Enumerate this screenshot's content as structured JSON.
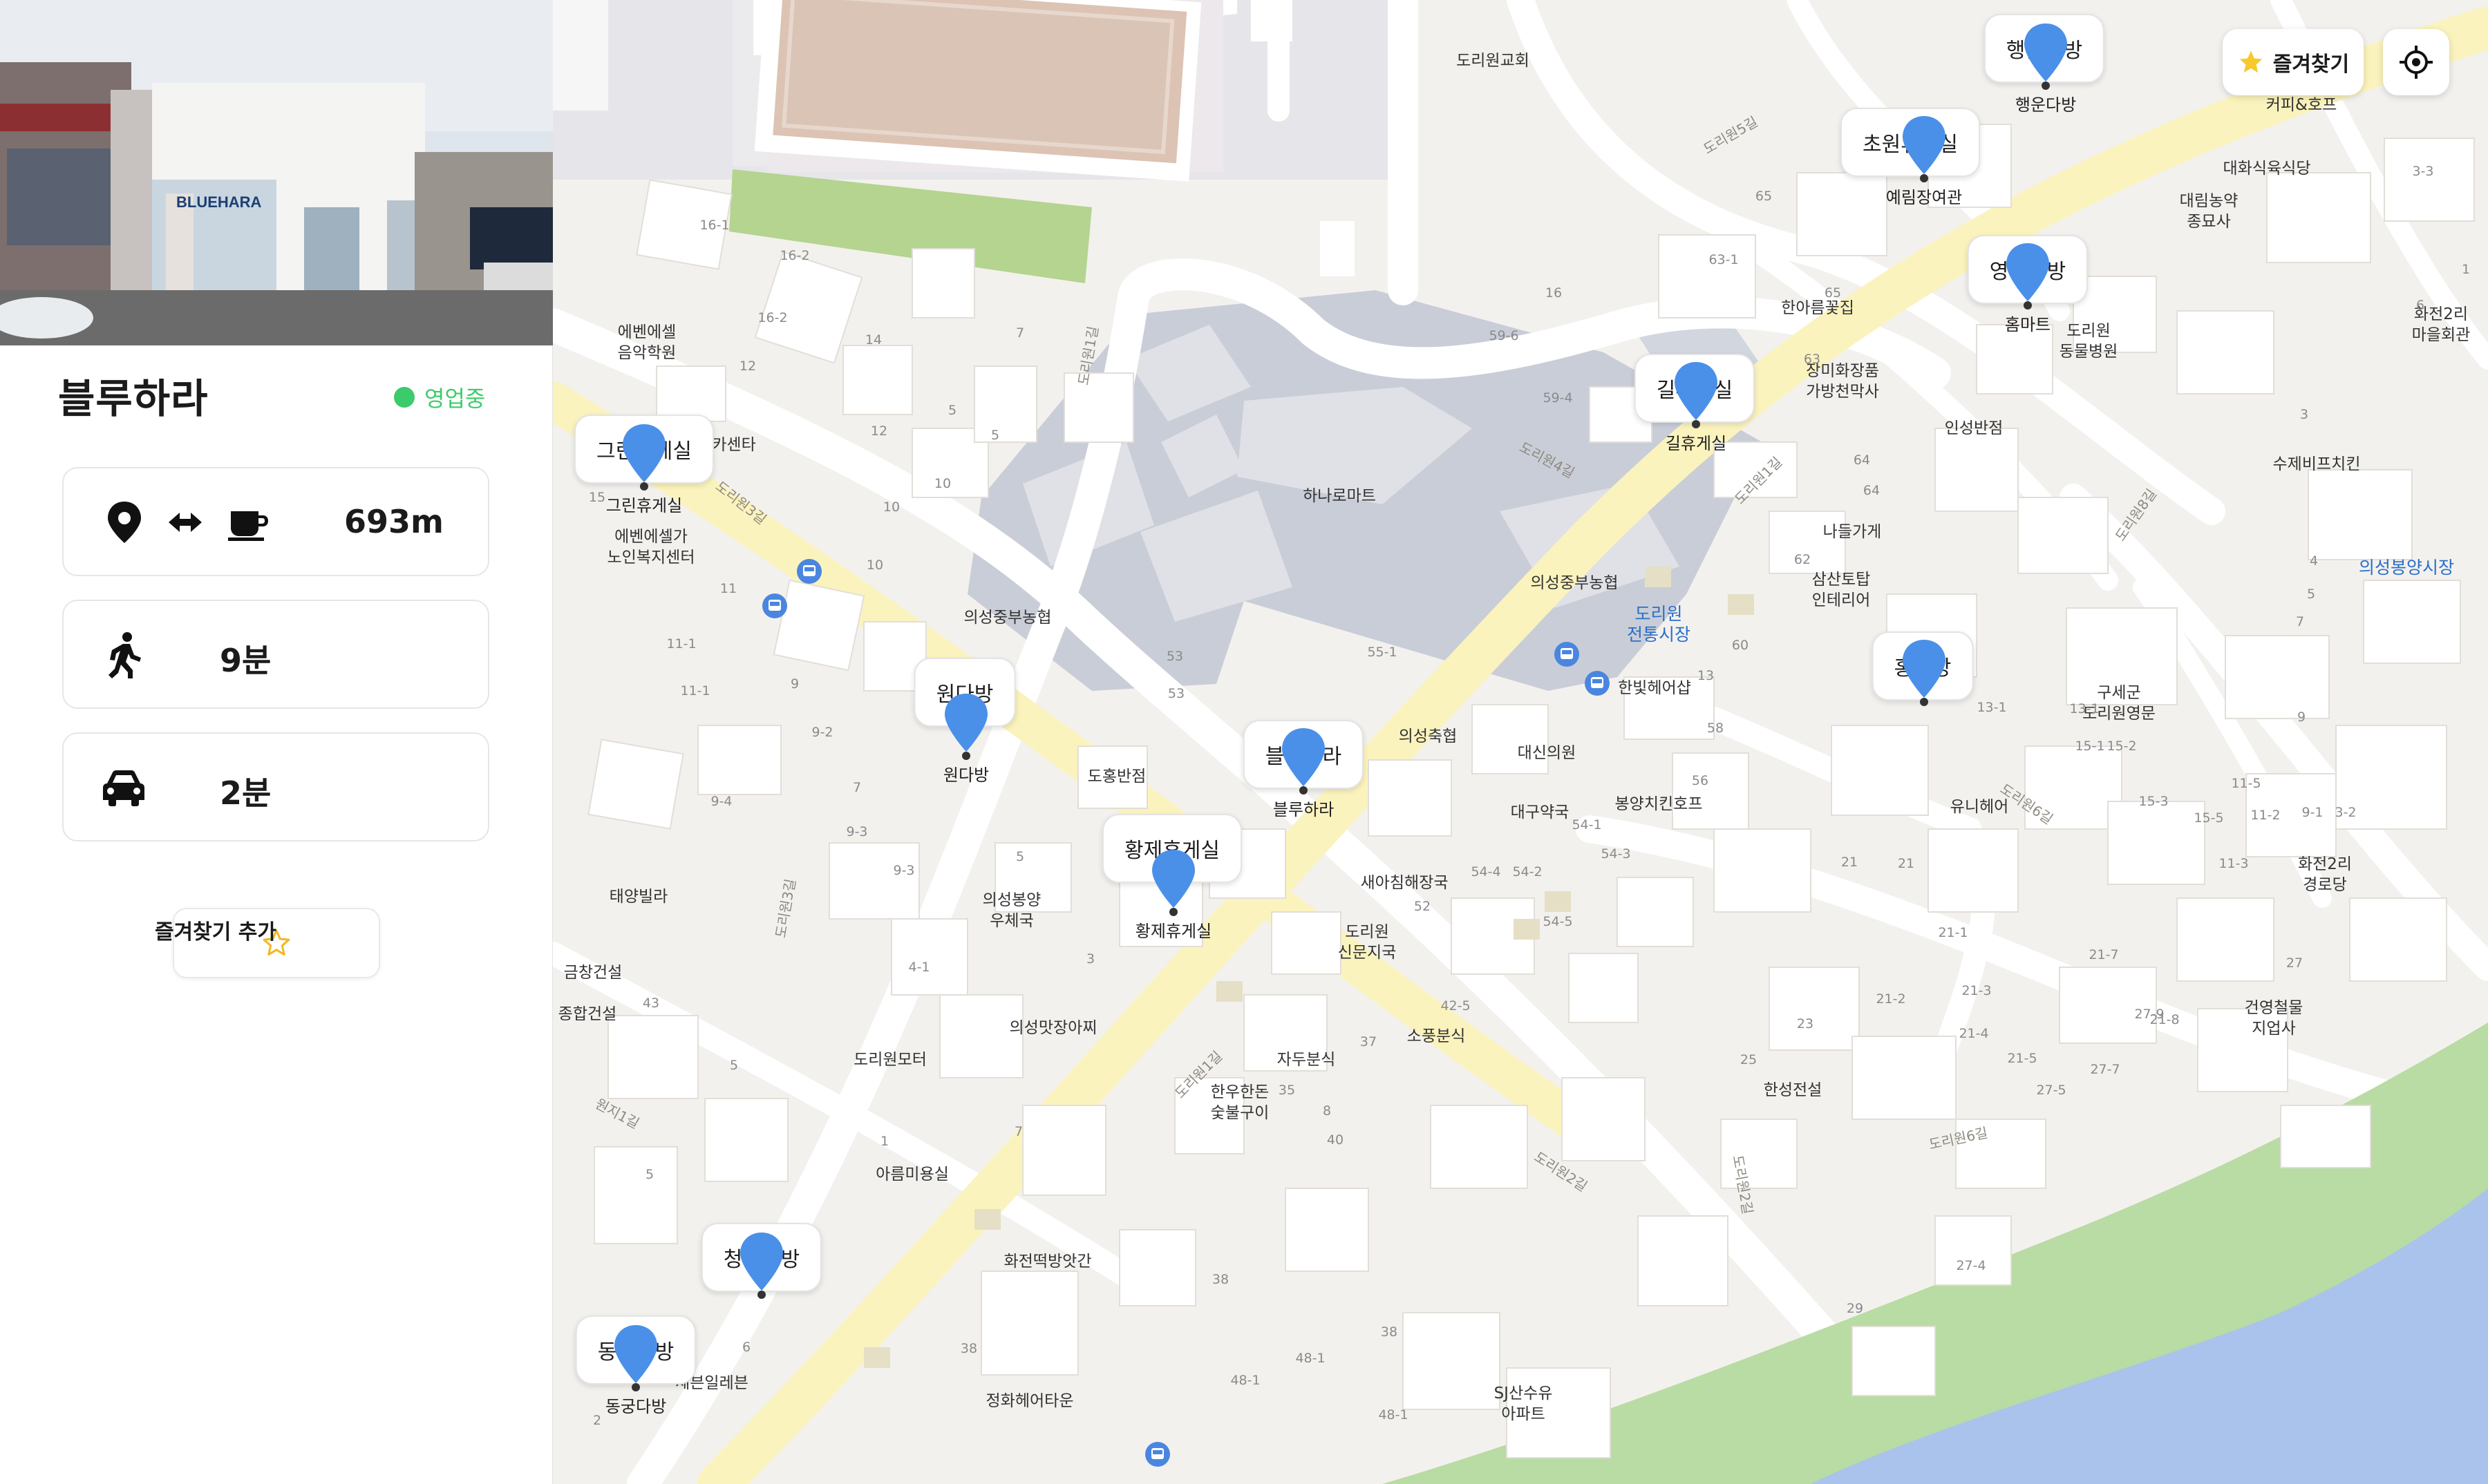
{
  "panel": {
    "title": "블루하라",
    "status": "영업중",
    "status_color": "#3ccb6a",
    "photo_sign": "BLUEHARA",
    "distance": {
      "from_icon": "location-pin-icon",
      "arrow_icon": "left-right-arrow-icon",
      "to_icon": "coffee-cup-icon",
      "value": "693m"
    },
    "walk": {
      "icon": "walking-person-icon",
      "value": "9분"
    },
    "car": {
      "icon": "car-icon",
      "value": "2분"
    },
    "favorite_add": {
      "icon": "star-outline-icon",
      "label": "즐겨찾기 추가"
    }
  },
  "map_controls": {
    "favorites": {
      "icon": "star-filled-icon",
      "label": "즐겨찾기",
      "color": "#f7c92c"
    },
    "locate": {
      "icon": "crosshair-icon"
    }
  },
  "colors": {
    "marker": "#4a90e8",
    "main_road": "#fbf3bd",
    "green": "#b9dba4",
    "water": "#a9c3ec"
  },
  "cafes": [
    {
      "name": "그린휴게실",
      "bubble": "그린휴게실"
    },
    {
      "name": "원다방",
      "bubble": "원다방"
    },
    {
      "name": "황제휴게실",
      "bubble": "황제휴게실"
    },
    {
      "name": "블루하라",
      "bubble": "블루하라"
    },
    {
      "name": "길휴게실",
      "bubble": "길휴게실"
    },
    {
      "name": "예림장여관",
      "bubble": "초원휴게실"
    },
    {
      "name": "행운다방",
      "bubble": "행운다방"
    },
    {
      "name": "홈마트",
      "bubble": "영암다방"
    },
    {
      "name": "",
      "bubble": "홍다방"
    },
    {
      "name": "",
      "bubble": "청원다방"
    },
    {
      "name": "동궁다방",
      "bubble": "동궁다방"
    }
  ],
  "places": {
    "dorwon_church": "도리원교회",
    "coffee_hof": "커피&호프",
    "daehwa_hall": "대화식육식당",
    "daerim": "대림농약\n종묘사",
    "hwajeon2_hall": "화전2리\n마을회관",
    "dorwon_vet": "도리원\n동물병원",
    "insung_banjeom": "인성반점",
    "sujebi_hof": "수제비프치킨",
    "uisung_bongyang_market": "의성봉양시장",
    "hanareum": "한아름꽃집",
    "jangmi": "장미화장품\n가방천막사",
    "narugage": "나들가게",
    "samsan": "삼산토탑\n인테리어",
    "hanaro": "하나로마트",
    "uisung_jungbu_nh": "의성중부농협",
    "dorwon_market": "도리원\n전통시장",
    "hanbit_hair": "한빛헤어샵",
    "guse_office": "구세군\n도리원영문",
    "uni_hair": "유니헤어",
    "hwajeon2_senior": "화전2리\n경로당",
    "uisung_chuk": "의성축협",
    "daesin_clinic": "대신의원",
    "daegu_pharm": "대구약국",
    "bongyang_chicken": "봉양치킨호프",
    "saea_haejang": "새아침해장국",
    "dorwon_post": "도리원\n신문지국",
    "sopung": "소풍분식",
    "dohong_banjeom": "도홍반점",
    "bongyang_post": "의성봉양\n우체국",
    "uisung_nh_left": "의성중부농협",
    "ebene_music": "에벤에셀\n음악학원",
    "card_center": "카센타",
    "senior_center": "에벤에셀가\n노인복지센터",
    "taeyang": "태양빌라",
    "geumchang": "금창건설",
    "jonghap": "종합건설",
    "dorwon_motel": "도리원모터",
    "uisung_mat": "의성맛장아찌",
    "jadu": "자두분식",
    "hanu": "한우한돈\n숯불구이",
    "areum": "아름미용실",
    "hwajeon_tteok": "화전떡방앗간",
    "seven": "세븐일레븐",
    "jungha_hair": "정화헤어타운",
    "sj_apt": "SJ산수유\n아파트",
    "hansung": "한성전설",
    "geonyeong": "건영철물\n지업사"
  },
  "roads": {
    "r1": "도리원1길",
    "r2": "도리원1길",
    "r3": "도리원2길",
    "r4": "도리원3길",
    "r5": "도리원4길",
    "r6": "도리원5길",
    "r7": "도리원6길",
    "r8": "도리원8길",
    "r9": "도리원2길",
    "r10": "도리원3길",
    "r11": "도리원6길",
    "r12": "원지1길",
    "r13": "도리원1길"
  },
  "lot_numbers": [
    "16-1",
    "16-2",
    "16-2",
    "14",
    "12",
    "12",
    "7",
    "5",
    "5",
    "10",
    "10",
    "10",
    "15",
    "11",
    "11-1",
    "11-1",
    "9",
    "9-2",
    "9-4",
    "9-3",
    "9-3",
    "7",
    "5",
    "4-1",
    "3",
    "53",
    "53",
    "55-1",
    "65",
    "63-1",
    "65",
    "16",
    "59-6",
    "59-4",
    "63",
    "64",
    "64",
    "62",
    "60",
    "58",
    "56",
    "54-1",
    "54-3",
    "52",
    "54-5",
    "54-2",
    "54-4",
    "21",
    "21",
    "21-1",
    "21-2",
    "21-3",
    "21-4",
    "21-5",
    "21-7",
    "21-8",
    "27",
    "27-4",
    "27-5",
    "27-7",
    "27-9",
    "29",
    "23",
    "25",
    "13",
    "13-1",
    "13-1",
    "15-1",
    "15-2",
    "15-3",
    "15-5",
    "11-3",
    "11-5",
    "11-2",
    "9-1",
    "9",
    "7",
    "5",
    "4",
    "3-2",
    "3-3",
    "1",
    "6",
    "3",
    "40",
    "42-5",
    "38",
    "38",
    "38",
    "48-1",
    "48-1",
    "48-1",
    "37",
    "35",
    "8",
    "6",
    "2",
    "43",
    "5",
    "1",
    "7",
    "5"
  ]
}
